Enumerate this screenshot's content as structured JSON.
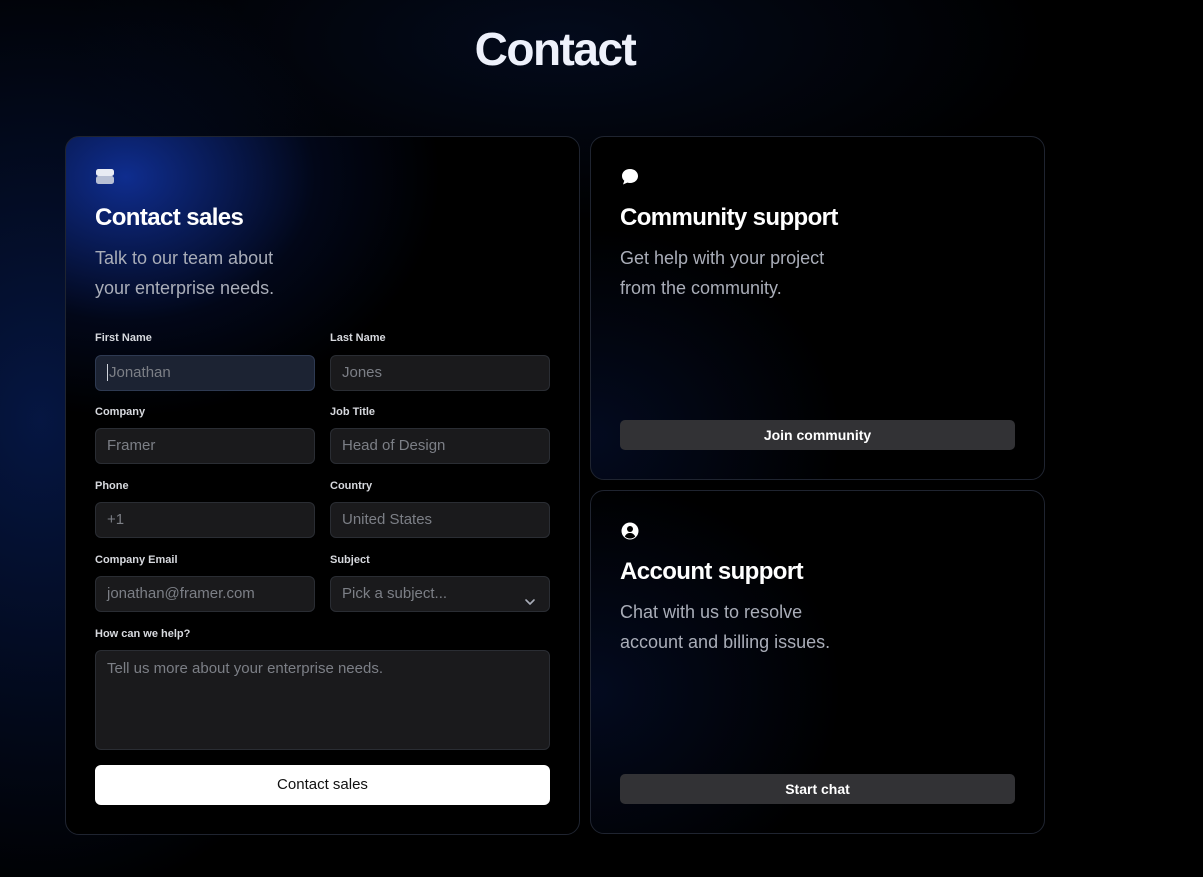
{
  "page": {
    "title": "Contact"
  },
  "sales": {
    "icon": "inbox-icon",
    "title": "Contact sales",
    "desc_line1": "Talk to our team about",
    "desc_line2": "your enterprise needs.",
    "fields": {
      "first_name": {
        "label": "First Name",
        "placeholder": "Jonathan"
      },
      "last_name": {
        "label": "Last Name",
        "placeholder": "Jones"
      },
      "company": {
        "label": "Company",
        "placeholder": "Framer"
      },
      "job_title": {
        "label": "Job Title",
        "placeholder": "Head of Design"
      },
      "phone": {
        "label": "Phone",
        "placeholder": "+1"
      },
      "country": {
        "label": "Country",
        "placeholder": "United States"
      },
      "email": {
        "label": "Company Email",
        "placeholder": "jonathan@framer.com"
      },
      "subject": {
        "label": "Subject",
        "placeholder": "Pick a subject..."
      },
      "help": {
        "label": "How can we help?",
        "placeholder": "Tell us more about your enterprise needs."
      }
    },
    "submit_label": "Contact sales"
  },
  "community": {
    "icon": "chat-bubble-icon",
    "title": "Community support",
    "desc_line1": "Get help with your project",
    "desc_line2": "from the community.",
    "button_label": "Join community"
  },
  "account": {
    "icon": "user-circle-icon",
    "title": "Account support",
    "desc_line1": "Chat with us to resolve",
    "desc_line2": "account and billing issues.",
    "button_label": "Start chat"
  },
  "colors": {
    "background": "#000000",
    "accent_glow": "#143cbe",
    "input_bg": "#1a1a1c",
    "button_secondary": "#323235",
    "button_primary": "#ffffff"
  }
}
